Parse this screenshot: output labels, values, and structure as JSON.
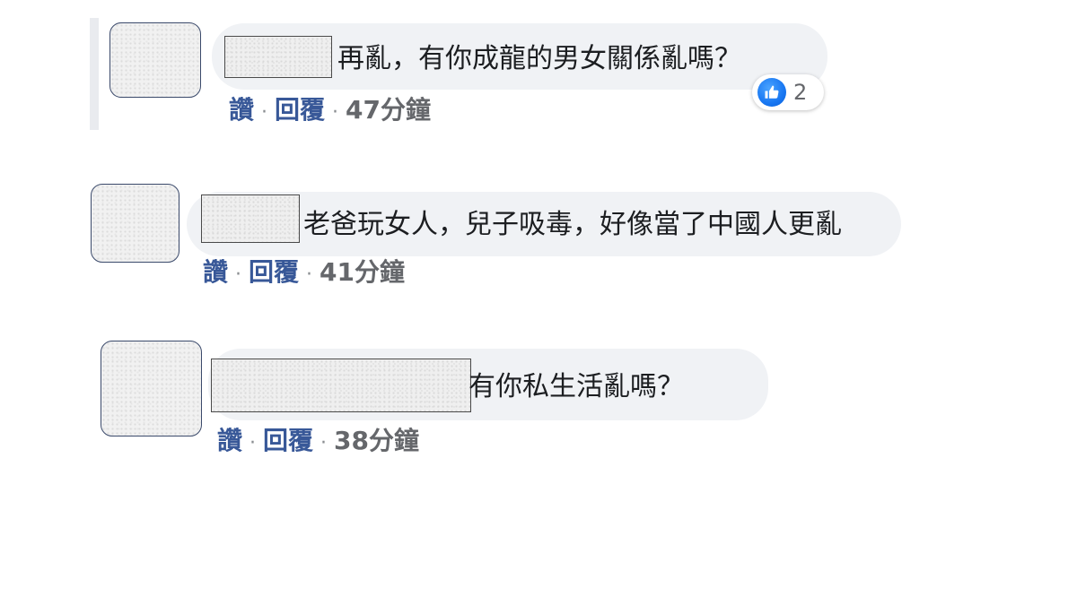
{
  "comments": [
    {
      "text": "再亂，有你成龍的男女關係亂嗎？",
      "like_label": "讚",
      "reply_label": "回覆",
      "time": "47分鐘",
      "reaction_count": "2",
      "reaction_icon": "like-icon"
    },
    {
      "text": "老爸玩女人，兒子吸毒，好像當了中國人更亂",
      "like_label": "讚",
      "reply_label": "回覆",
      "time": "41分鐘"
    },
    {
      "text": "有你私生活亂嗎？",
      "like_label": "讚",
      "reply_label": "回覆",
      "time": "38分鐘"
    }
  ],
  "colors": {
    "bubble_bg": "#f0f2f5",
    "link": "#385898",
    "meta": "#65676b",
    "like_blue": "#1877f2"
  }
}
